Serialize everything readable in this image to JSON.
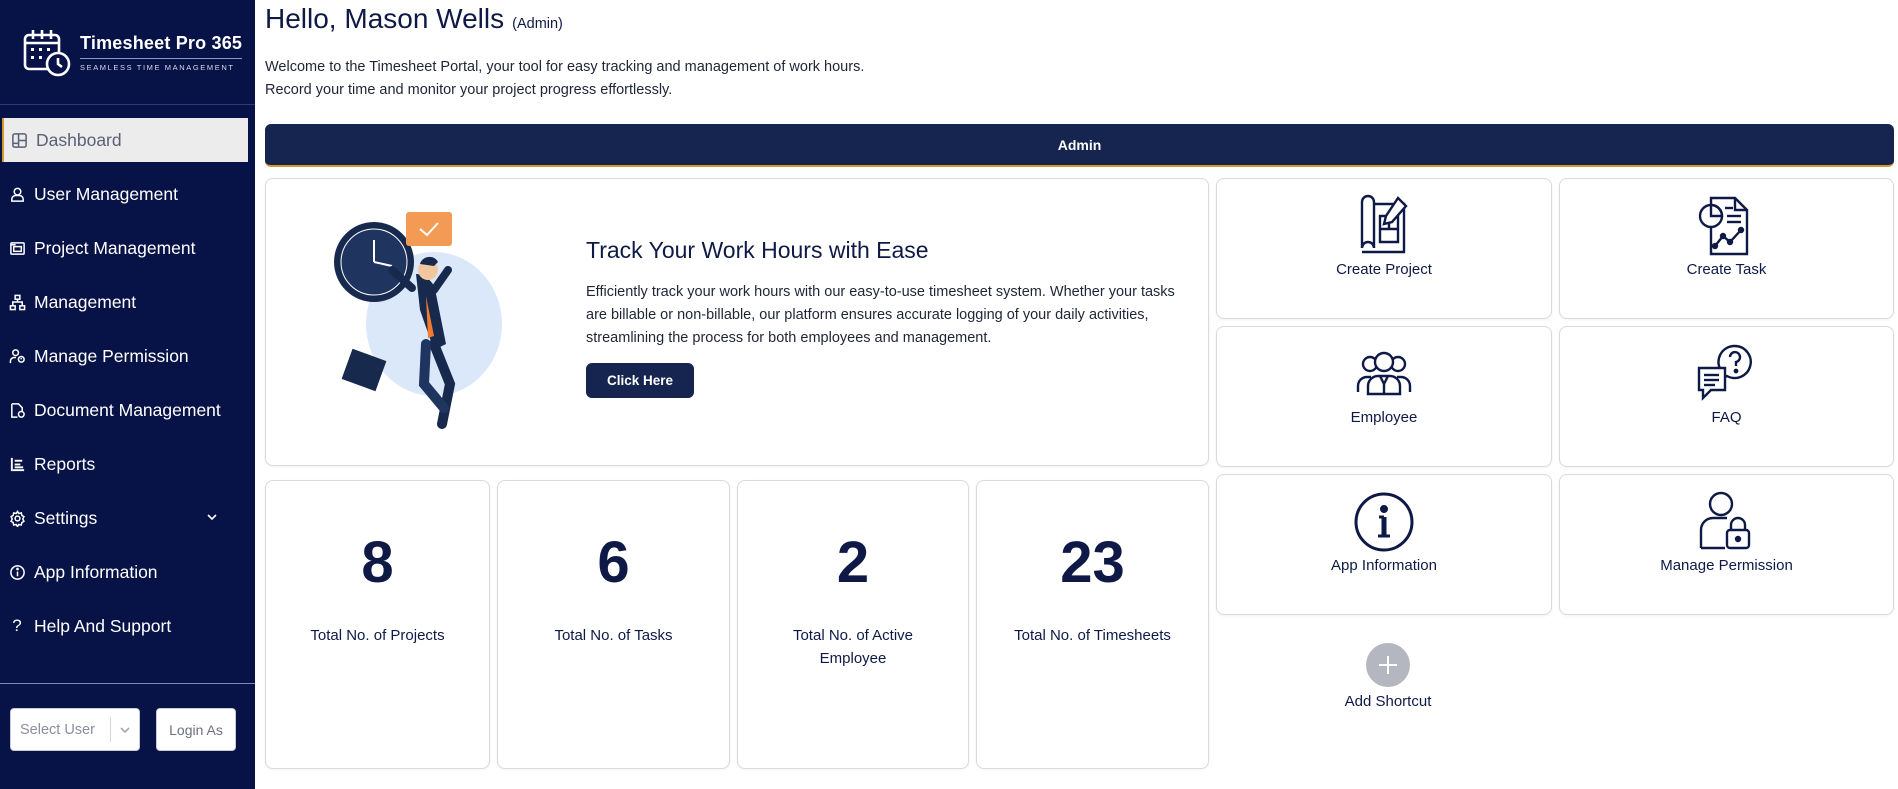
{
  "brand": {
    "name": "Timesheet Pro 365",
    "tagline": "SEAMLESS TIME MANAGEMENT"
  },
  "sidebar": {
    "items": [
      {
        "label": "Dashboard",
        "icon": "dashboard-icon",
        "active": true
      },
      {
        "label": "User Management",
        "icon": "user-icon"
      },
      {
        "label": "Project Management",
        "icon": "folders-icon"
      },
      {
        "label": "Management",
        "icon": "hierarchy-icon"
      },
      {
        "label": "Manage Permission",
        "icon": "user-permission-icon"
      },
      {
        "label": "Document Management",
        "icon": "document-icon"
      },
      {
        "label": "Reports",
        "icon": "report-icon"
      },
      {
        "label": "Settings",
        "icon": "gear-icon",
        "has_submenu": true
      },
      {
        "label": "App Information",
        "icon": "info-icon"
      },
      {
        "label": "Help And Support",
        "icon": "question-icon"
      }
    ],
    "select_user_placeholder": "Select User",
    "login_as_label": "Login As"
  },
  "header": {
    "greeting": "Hello, Mason Wells",
    "role": "(Admin)",
    "welcome_line1": "Welcome to the Timesheet Portal, your tool for easy tracking and management of work hours.",
    "welcome_line2": "Record your time and monitor your project progress effortlessly."
  },
  "admin_bar": {
    "label": "Admin"
  },
  "hero": {
    "title": "Track Your Work Hours with Ease",
    "text": "Efficiently track your work hours with our easy-to-use timesheet system. Whether your tasks are billable or non-billable, our platform ensures accurate logging of your daily activities, streamlining the process for both employees and management.",
    "button_label": "Click Here"
  },
  "shortcuts": [
    {
      "label": "Create Project",
      "icon": "blueprint-icon"
    },
    {
      "label": "Create Task",
      "icon": "task-report-icon"
    },
    {
      "label": "Employee",
      "icon": "employee-group-icon"
    },
    {
      "label": "FAQ",
      "icon": "faq-chat-icon"
    },
    {
      "label": "App Information",
      "icon": "info-circle-icon"
    },
    {
      "label": "Manage Permission",
      "icon": "user-lock-icon"
    }
  ],
  "add_shortcut_label": "Add Shortcut",
  "stats": [
    {
      "value": "8",
      "label": "Total No. of Projects"
    },
    {
      "value": "6",
      "label": "Total No. of Tasks"
    },
    {
      "value": "2",
      "label": "Total No. of Active Employee"
    },
    {
      "value": "23",
      "label": "Total No. of Timesheets"
    }
  ],
  "colors": {
    "sidebar_bg": "#071247",
    "primary": "#15254f",
    "accent": "#d39a2a",
    "text": "#0e1a45"
  }
}
